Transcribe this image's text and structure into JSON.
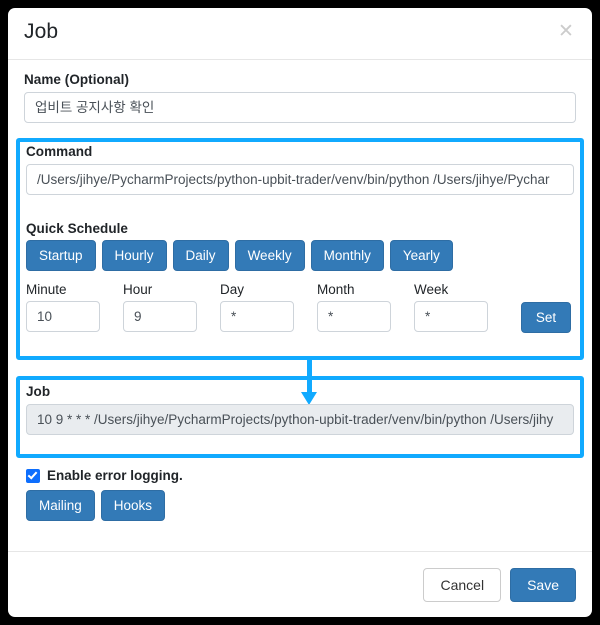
{
  "modal": {
    "title": "Job",
    "close_icon": "✕"
  },
  "name_section": {
    "label": "Name (Optional)",
    "value": "업비트 공지사항 확인",
    "placeholder": ""
  },
  "command_section": {
    "label": "Command",
    "value": "/Users/jihye/PycharmProjects/python-upbit-trader/venv/bin/python /Users/jihye/Pychar",
    "placeholder": ""
  },
  "quick_schedule": {
    "label": "Quick Schedule",
    "buttons": [
      {
        "label": "Startup"
      },
      {
        "label": "Hourly"
      },
      {
        "label": "Daily"
      },
      {
        "label": "Weekly"
      },
      {
        "label": "Monthly"
      },
      {
        "label": "Yearly"
      }
    ]
  },
  "cron": {
    "fields": [
      {
        "label": "Minute",
        "value": "10"
      },
      {
        "label": "Hour",
        "value": "9"
      },
      {
        "label": "Day",
        "value": "*"
      },
      {
        "label": "Month",
        "value": "*"
      },
      {
        "label": "Week",
        "value": "*"
      }
    ],
    "set_label": "Set"
  },
  "job_output": {
    "label": "Job",
    "value": "10 9 * * * /Users/jihye/PycharmProjects/python-upbit-trader/venv/bin/python /Users/jihy"
  },
  "logging": {
    "checkbox_label": "Enable error logging.",
    "checked": true,
    "buttons": [
      {
        "label": "Mailing"
      },
      {
        "label": "Hooks"
      }
    ]
  },
  "footer": {
    "cancel_label": "Cancel",
    "save_label": "Save"
  },
  "colors": {
    "highlight": "#11aaff",
    "primary_button": "#337ab7",
    "checkbox": "#0d6efd",
    "backdrop": "#000000",
    "modal_bg": "#ffffff"
  }
}
